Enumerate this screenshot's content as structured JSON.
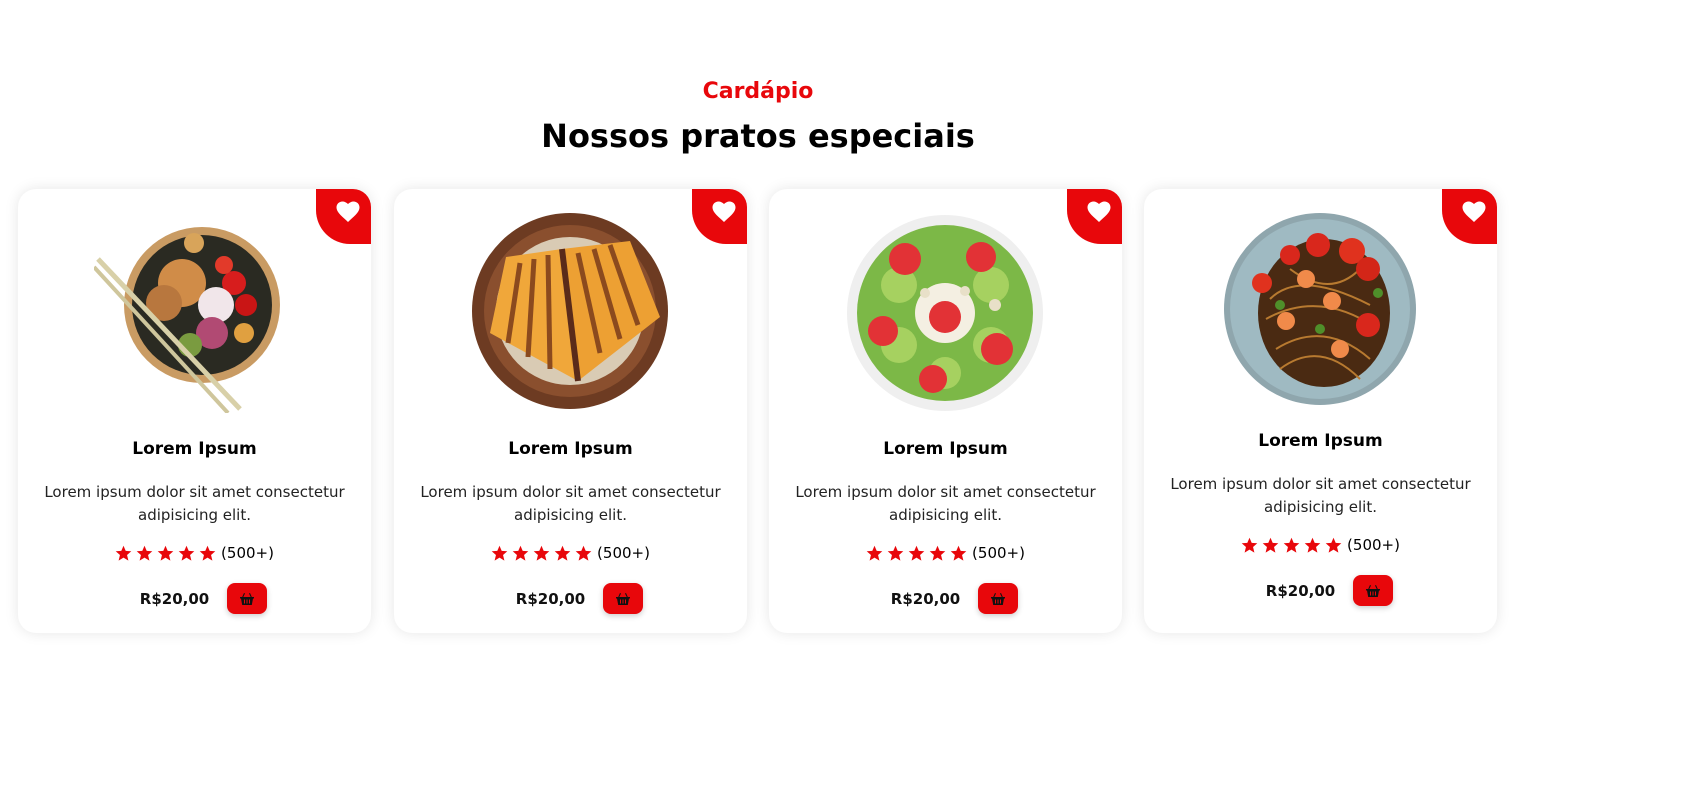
{
  "section": {
    "subtitle": "Cardápio",
    "title": "Nossos pratos especiais"
  },
  "colors": {
    "accent": "#e8070b",
    "text": "#000000"
  },
  "cards": [
    {
      "image": "poke-bowl-image",
      "name": "Lorem Ipsum",
      "description": "Lorem ipsum dolor sit amet consectetur adipisicing elit.",
      "rating": 5,
      "reviews": "(500+)",
      "price": "R$20,00"
    },
    {
      "image": "grilled-sandwich-image",
      "name": "Lorem Ipsum",
      "description": "Lorem ipsum dolor sit amet consectetur adipisicing elit.",
      "rating": 5,
      "reviews": "(500+)",
      "price": "R$20,00"
    },
    {
      "image": "kiwi-strawberry-bowl-image",
      "name": "Lorem Ipsum",
      "description": "Lorem ipsum dolor sit amet consectetur adipisicing elit.",
      "rating": 5,
      "reviews": "(500+)",
      "price": "R$20,00"
    },
    {
      "image": "shrimp-noodles-image",
      "name": "Lorem Ipsum",
      "description": "Lorem ipsum dolor sit amet consectetur adipisicing elit.",
      "rating": 5,
      "reviews": "(500+)",
      "price": "R$20,00"
    }
  ]
}
